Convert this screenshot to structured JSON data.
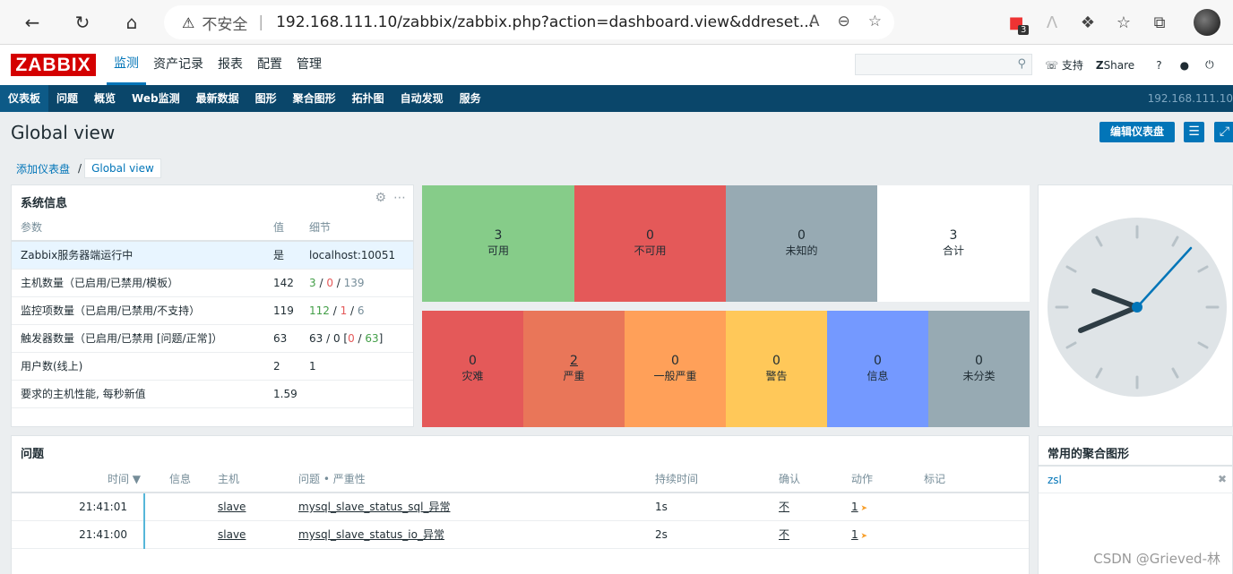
{
  "browser": {
    "security_label": "不安全",
    "url": "192.168.111.10/zabbix/zabbix.php?action=dashboard.view&ddreset...",
    "ext_badge": "3"
  },
  "header": {
    "logo": "ZABBIX",
    "menu": [
      "监测",
      "资产记录",
      "报表",
      "配置",
      "管理"
    ],
    "support": "支持",
    "share": "Share",
    "help": "?",
    "user_icon": "user-icon",
    "logout_icon": "power-icon"
  },
  "submenu": {
    "items": [
      "仪表板",
      "问题",
      "概览",
      "Web监测",
      "最新数据",
      "图形",
      "聚合图形",
      "拓扑图",
      "自动发现",
      "服务"
    ],
    "server_ip": "192.168.111.10"
  },
  "page": {
    "title": "Global view",
    "edit_button": "编辑仪表盘",
    "breadcrumb": [
      "添加仪表盘",
      "Global view"
    ]
  },
  "system_info": {
    "title": "系统信息",
    "headers": [
      "参数",
      "值",
      "细节"
    ],
    "rows": [
      {
        "param": "Zabbix服务器端运行中",
        "value": "是",
        "detail": "localhost:10051"
      },
      {
        "param": "主机数量（已启用/已禁用/模板）",
        "value": "142",
        "d1": "3",
        "d2": "0",
        "d3": "139"
      },
      {
        "param": "监控项数量（已启用/已禁用/不支持）",
        "value": "119",
        "d1": "112",
        "d2": "1",
        "d3": "6"
      },
      {
        "param": "触发器数量（已启用/已禁用 [问题/正常]）",
        "value": "63",
        "d1": "63 / 0 [",
        "d2": "0",
        "d3": "63",
        "d4": "]"
      },
      {
        "param": "用户数(线上)",
        "value": "2",
        "detail": "1"
      },
      {
        "param": "要求的主机性能, 每秒新值",
        "value": "1.59",
        "detail": ""
      }
    ]
  },
  "host_availability": [
    {
      "count": "3",
      "label": "可用",
      "color": "#86cc89"
    },
    {
      "count": "0",
      "label": "不可用",
      "color": "#e45959"
    },
    {
      "count": "0",
      "label": "未知的",
      "color": "#97aab3"
    },
    {
      "count": "3",
      "label": "合计",
      "color": "#ffffff"
    }
  ],
  "problems_by_severity": [
    {
      "count": "0",
      "label": "灾难",
      "color": "#e45959"
    },
    {
      "count": "2",
      "label": "严重",
      "color": "#e97659"
    },
    {
      "count": "0",
      "label": "一般严重",
      "color": "#ffa059"
    },
    {
      "count": "0",
      "label": "警告",
      "color": "#ffc859"
    },
    {
      "count": "0",
      "label": "信息",
      "color": "#7499ff"
    },
    {
      "count": "0",
      "label": "未分类",
      "color": "#97aab3"
    }
  ],
  "problems": {
    "title": "问题",
    "headers": [
      "时间 ▼",
      "信息",
      "主机",
      "问题 • 严重性",
      "持续时间",
      "确认",
      "动作",
      "标记"
    ],
    "rows": [
      {
        "time": "21:41:01",
        "host": "slave",
        "problem": "mysql_slave_status_sql_异常",
        "duration": "1s",
        "ack": "不",
        "actions": "1"
      },
      {
        "time": "21:41:00",
        "host": "slave",
        "problem": "mysql_slave_status_io_异常",
        "duration": "2s",
        "ack": "不",
        "actions": "1"
      }
    ]
  },
  "fav_graphs": {
    "title": "常用的聚合图形",
    "items": [
      "zsl"
    ]
  },
  "watermark": "CSDN @Grieved-林"
}
